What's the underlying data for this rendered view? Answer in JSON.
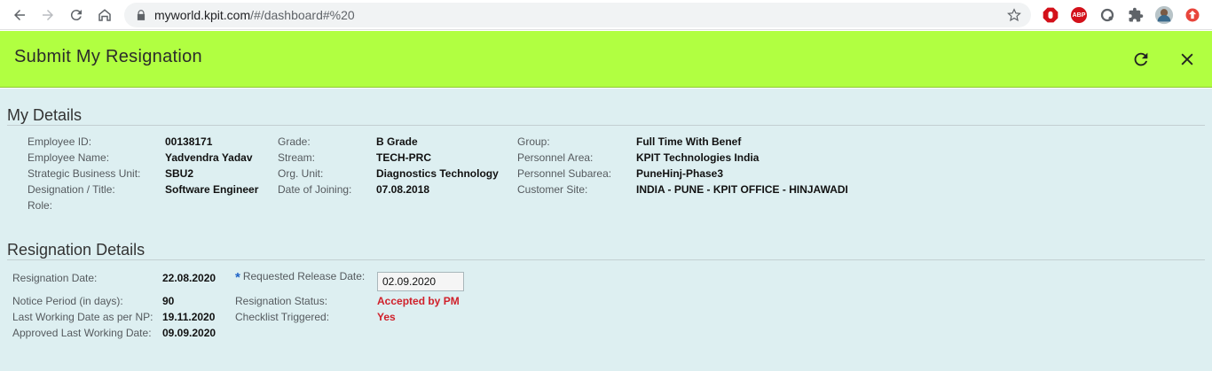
{
  "browser": {
    "url_host": "myworld.kpit.com",
    "url_path": "/#/dashboard#%20"
  },
  "header": {
    "title": "Submit My Resignation"
  },
  "my_details": {
    "title": "My Details",
    "fields": {
      "employee_id": {
        "label": "Employee ID:",
        "value": "00138171"
      },
      "employee_name": {
        "label": "Employee Name:",
        "value": "Yadvendra Yadav"
      },
      "sbu": {
        "label": "Strategic Business Unit:",
        "value": "SBU2"
      },
      "designation": {
        "label": "Designation / Title:",
        "value": "Software Engineer"
      },
      "role": {
        "label": "Role:",
        "value": ""
      },
      "grade": {
        "label": "Grade:",
        "value": "B Grade"
      },
      "stream": {
        "label": "Stream:",
        "value": "TECH-PRC"
      },
      "org_unit": {
        "label": "Org. Unit:",
        "value": "Diagnostics Technology"
      },
      "doj": {
        "label": "Date of Joining:",
        "value": "07.08.2018"
      },
      "group": {
        "label": "Group:",
        "value": "Full Time With Benef"
      },
      "personnel_area": {
        "label": "Personnel Area:",
        "value": "KPIT Technologies India"
      },
      "personnel_subarea": {
        "label": "Personnel Subarea:",
        "value": "PuneHinj-Phase3"
      },
      "customer_site": {
        "label": "Customer Site:",
        "value": "INDIA - PUNE - KPIT OFFICE - HINJAWADI"
      }
    }
  },
  "resignation": {
    "title": "Resignation Details",
    "fields": {
      "resignation_date": {
        "label": "Resignation Date:",
        "value": "22.08.2020"
      },
      "notice_period": {
        "label": "Notice Period (in days):",
        "value": "90"
      },
      "lwd_np": {
        "label": "Last Working Date as per NP:",
        "value": "19.11.2020"
      },
      "approved_lwd": {
        "label": "Approved Last Working Date:",
        "value": "09.09.2020"
      },
      "requested_release": {
        "asterisk": "*",
        "label": "Requested Release Date:",
        "value": "02.09.2020"
      },
      "status": {
        "label": "Resignation Status:",
        "value": "Accepted by PM"
      },
      "checklist": {
        "label": "Checklist Triggered:",
        "value": "Yes"
      }
    }
  },
  "colors": {
    "header_bg": "#b1ff41",
    "content_bg": "#ddeff1",
    "status_red": "#d0202a",
    "asterisk_blue": "#1f63c7"
  },
  "icons": {
    "back": "arrow-left-icon",
    "forward": "arrow-right-icon",
    "reload": "reload-icon",
    "home": "home-icon",
    "lock": "lock-icon",
    "bookmark": "star-icon",
    "refresh": "refresh-icon",
    "close": "close-icon"
  }
}
